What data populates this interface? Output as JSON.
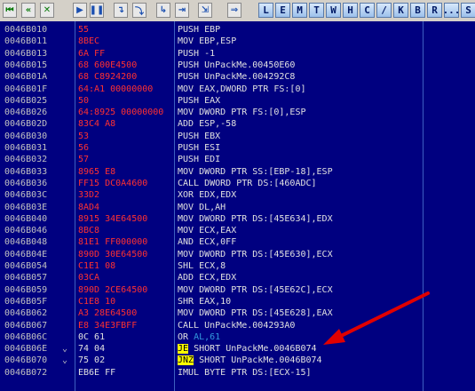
{
  "toolbar": {
    "buttons": [
      {
        "name": "rewind-icon",
        "glyph": "⏮"
      },
      {
        "name": "step-back-icon",
        "glyph": "«"
      },
      {
        "name": "close-icon",
        "glyph": "✕"
      },
      {
        "name": "run-icon",
        "glyph": "▶"
      },
      {
        "name": "pause-icon",
        "glyph": "❚❚"
      },
      {
        "name": "step-into-icon",
        "glyph": "↴"
      },
      {
        "name": "step-over-icon",
        "glyph": "⤵"
      },
      {
        "name": "animate-into-icon",
        "glyph": "↳"
      },
      {
        "name": "animate-over-icon",
        "glyph": "⇥"
      },
      {
        "name": "execute-till-return-icon",
        "glyph": "⇲"
      },
      {
        "name": "go-to-icon",
        "glyph": "⇒"
      }
    ],
    "letters": [
      "L",
      "E",
      "M",
      "T",
      "W",
      "H",
      "C",
      "/",
      "K",
      "B",
      "R",
      "...",
      "S"
    ]
  },
  "disasm": {
    "rows": [
      {
        "addr": "0046B010",
        "mark": "",
        "hex": "55",
        "asm": "PUSH EBP"
      },
      {
        "addr": "0046B011",
        "mark": "",
        "hex": "8BEC",
        "asm": "MOV EBP,ESP"
      },
      {
        "addr": "0046B013",
        "mark": "",
        "hex": "6A FF",
        "asm": "PUSH -1"
      },
      {
        "addr": "0046B015",
        "mark": "",
        "hex": "68 600E4500",
        "asm": "PUSH UnPackMe.00450E60"
      },
      {
        "addr": "0046B01A",
        "mark": "",
        "hex": "68 C8924200",
        "asm": "PUSH UnPackMe.004292C8"
      },
      {
        "addr": "0046B01F",
        "mark": "",
        "hex": "64:A1 00000000",
        "asm": "MOV EAX,DWORD PTR FS:[0]"
      },
      {
        "addr": "0046B025",
        "mark": "",
        "hex": "50",
        "asm": "PUSH EAX"
      },
      {
        "addr": "0046B026",
        "mark": "",
        "hex": "64:8925 00000000",
        "asm": "MOV DWORD PTR FS:[0],ESP"
      },
      {
        "addr": "0046B02D",
        "mark": "",
        "hex": "83C4 A8",
        "asm": "ADD ESP,-58"
      },
      {
        "addr": "0046B030",
        "mark": "",
        "hex": "53",
        "asm": "PUSH EBX"
      },
      {
        "addr": "0046B031",
        "mark": "",
        "hex": "56",
        "asm": "PUSH ESI"
      },
      {
        "addr": "0046B032",
        "mark": "",
        "hex": "57",
        "asm": "PUSH EDI"
      },
      {
        "addr": "0046B033",
        "mark": "",
        "hex": "8965 E8",
        "asm": "MOV DWORD PTR SS:[EBP-18],ESP"
      },
      {
        "addr": "0046B036",
        "mark": "",
        "hex": "FF15 DC0A4600",
        "asm": "CALL DWORD PTR DS:[460ADC]"
      },
      {
        "addr": "0046B03C",
        "mark": "",
        "hex": "33D2",
        "asm": "XOR EDX,EDX"
      },
      {
        "addr": "0046B03E",
        "mark": "",
        "hex": "8AD4",
        "asm": "MOV DL,AH"
      },
      {
        "addr": "0046B040",
        "mark": "",
        "hex": "8915 34E64500",
        "asm": "MOV DWORD PTR DS:[45E634],EDX"
      },
      {
        "addr": "0046B046",
        "mark": "",
        "hex": "8BC8",
        "asm": "MOV ECX,EAX"
      },
      {
        "addr": "0046B048",
        "mark": "",
        "hex": "81E1 FF000000",
        "asm": "AND ECX,0FF"
      },
      {
        "addr": "0046B04E",
        "mark": "",
        "hex": "890D 30E64500",
        "asm": "MOV DWORD PTR DS:[45E630],ECX"
      },
      {
        "addr": "0046B054",
        "mark": "",
        "hex": "C1E1 08",
        "asm": "SHL ECX,8"
      },
      {
        "addr": "0046B057",
        "mark": "",
        "hex": "03CA",
        "asm": "ADD ECX,EDX"
      },
      {
        "addr": "0046B059",
        "mark": "",
        "hex": "890D 2CE64500",
        "asm": "MOV DWORD PTR DS:[45E62C],ECX"
      },
      {
        "addr": "0046B05F",
        "mark": "",
        "hex": "C1E8 10",
        "asm": "SHR EAX,10"
      },
      {
        "addr": "0046B062",
        "mark": "",
        "hex": "A3 28E64500",
        "asm": "MOV DWORD PTR DS:[45E628],EAX"
      },
      {
        "addr": "0046B067",
        "mark": "",
        "hex": "E8 34E3FBFF",
        "asm": "CALL UnPackMe.004293A0"
      },
      {
        "addr": "0046B06C",
        "mark": "",
        "hex": "0C 61",
        "asm": "OR AL,61",
        "white": true,
        "asm_a": "OR ",
        "asm_b": "AL",
        "asm_c": ",61"
      },
      {
        "addr": "0046B06E",
        "mark": "⌄",
        "hex": "74 04",
        "asm": "JE SHORT UnPackMe.0046B074",
        "white": true,
        "op": "JE",
        "rest": " SHORT UnPackMe.0046B074"
      },
      {
        "addr": "0046B070",
        "mark": "⌄",
        "hex": "75 02",
        "asm": "JNZ SHORT UnPackMe.0046B074",
        "white": true,
        "op": "JNZ",
        "rest": " SHORT UnPackMe.0046B074"
      },
      {
        "addr": "0046B072",
        "mark": "",
        "hex": "EB6E FF",
        "asm": "IMUL BYTE PTR DS:[ECX-15]",
        "white": true
      }
    ]
  },
  "colors": {
    "background": "#000080",
    "address": "#c0c0c0",
    "hex": "#ff3030",
    "highlight": "#ffff00",
    "annotation_arrow": "#e00000"
  }
}
